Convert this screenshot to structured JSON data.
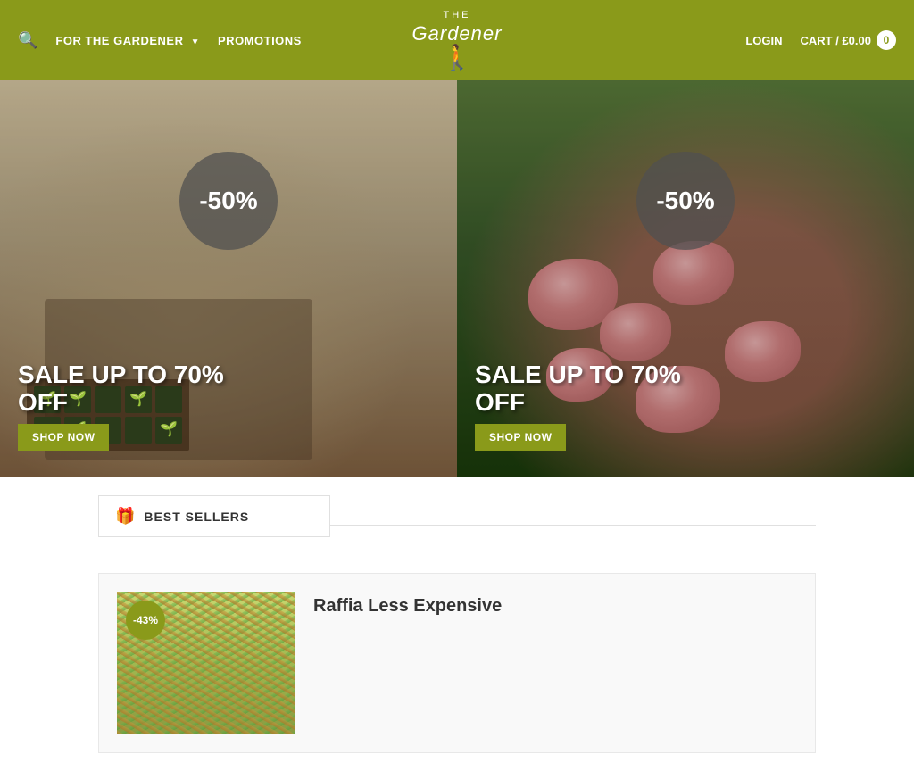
{
  "header": {
    "logo_the": "THE",
    "logo_gardener": "Gardener",
    "nav_items": [
      {
        "label": "FOR THE GARDENER",
        "has_dropdown": true
      },
      {
        "label": "PROMOTIONS",
        "has_dropdown": false
      }
    ],
    "login_label": "LOGIN",
    "cart_label": "CART / £0.00",
    "cart_count": "0"
  },
  "hero": {
    "left": {
      "discount": "-50%",
      "sale_title_line1": "SALE UP TO 70%",
      "sale_title_line2": "OFF",
      "shop_now": "SHOP NOW"
    },
    "right": {
      "discount": "-50%",
      "sale_title_line1": "SALE UP TO 70%",
      "sale_title_line2": "OFF",
      "shop_now": "SHOP NOW"
    }
  },
  "best_sellers": {
    "section_title": "BEST SELLERS",
    "product": {
      "discount_tag": "-43%",
      "title": "Raffia Less Expensive"
    }
  }
}
